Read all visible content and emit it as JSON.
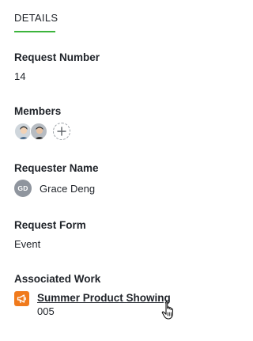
{
  "tab": {
    "label": "DETAILS",
    "accent": "#3cb43c"
  },
  "request_number": {
    "title": "Request Number",
    "value": "14"
  },
  "members": {
    "title": "Members",
    "avatars": [
      "avatar",
      "avatar"
    ],
    "add_icon": "plus-icon"
  },
  "requester": {
    "title": "Requester Name",
    "initials": "GD",
    "name": "Grace Deng"
  },
  "request_form": {
    "title": "Request Form",
    "value": "Event"
  },
  "associated_work": {
    "title": "Associated Work",
    "icon": "megaphone-icon",
    "icon_color": "#f07a1c",
    "name": "Summer Product Showing",
    "id": "005"
  },
  "cursor": "hand-pointer-icon"
}
